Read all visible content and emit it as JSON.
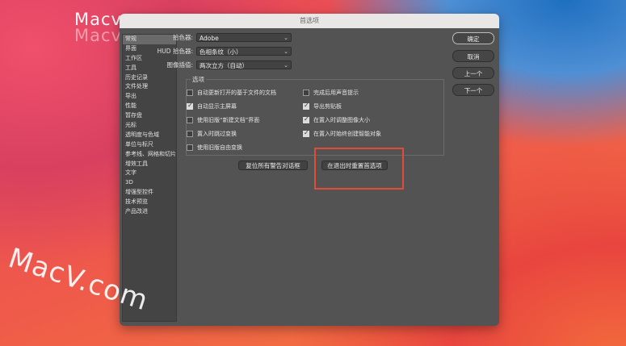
{
  "watermark": {
    "top": "Macv.com",
    "top_echo": "Macv.com",
    "big": "MacV.com"
  },
  "window": {
    "title": "首选项"
  },
  "sidebar": {
    "items": [
      {
        "label": "常规",
        "active": true
      },
      {
        "label": "界面"
      },
      {
        "label": "工作区"
      },
      {
        "label": "工具"
      },
      {
        "label": "历史记录"
      },
      {
        "label": "文件处理"
      },
      {
        "label": "导出"
      },
      {
        "label": "性能"
      },
      {
        "label": "暂存盘"
      },
      {
        "label": "光标"
      },
      {
        "label": "透明度与色域"
      },
      {
        "label": "单位与标尺"
      },
      {
        "label": "参考线、网格和切片"
      },
      {
        "label": "增效工具"
      },
      {
        "label": "文字"
      },
      {
        "label": "3D"
      },
      {
        "label": "增强型控件"
      },
      {
        "label": "技术预览"
      },
      {
        "label": "产品改进"
      }
    ]
  },
  "fields": {
    "color_picker": {
      "label": "拾色器:",
      "value": "Adobe"
    },
    "hud_picker": {
      "label": "HUD 拾色器:",
      "value": "色相条纹（小）"
    },
    "interpolation": {
      "label": "图像插值:",
      "value": "两次立方（自动）"
    }
  },
  "options": {
    "title": "选项",
    "left": [
      {
        "label": "自动更新打开的基于文件的文档",
        "checked": false
      },
      {
        "label": "自动显示主屏幕",
        "checked": true
      },
      {
        "label": "使用旧版“新建文档”界面",
        "checked": false
      },
      {
        "label": "置入时跳过变换",
        "checked": false
      },
      {
        "label": "使用旧版自由变换",
        "checked": false
      }
    ],
    "right": [
      {
        "label": "完成后用声音提示",
        "checked": false
      },
      {
        "label": "导出剪贴板",
        "checked": true
      },
      {
        "label": "在置入时调整图像大小",
        "checked": true
      },
      {
        "label": "在置入时始终创建智能对象",
        "checked": true
      }
    ]
  },
  "buttons": {
    "reset_warnings": "复位所有警告对话框",
    "reset_on_quit": "在退出时重置首选项",
    "ok": "确定",
    "cancel": "取消",
    "prev": "上一个",
    "next": "下一个"
  },
  "colors": {
    "highlight": "#e24a3a",
    "panel": "#535353"
  }
}
